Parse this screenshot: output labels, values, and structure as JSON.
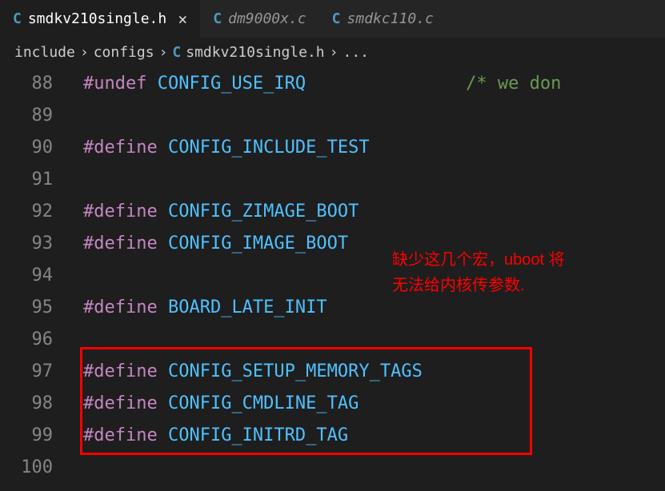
{
  "tabs": [
    {
      "icon": "C",
      "name": "smdkv210single.h",
      "active": true,
      "close": "×"
    },
    {
      "icon": "C",
      "name": "dm9000x.c",
      "active": false
    },
    {
      "icon": "C",
      "name": "smdkc110.c",
      "active": false
    }
  ],
  "breadcrumb": {
    "parts": [
      "include",
      "configs"
    ],
    "file_icon": "C",
    "file": "smdkv210single.h",
    "more": "..."
  },
  "lines": [
    {
      "num": "88",
      "prefix": "#undef ",
      "macro": "CONFIG_USE_IRQ",
      "suffix": "",
      "comment": "/* we don"
    },
    {
      "num": "89",
      "empty": true
    },
    {
      "num": "90",
      "prefix": "#define ",
      "macro": "CONFIG_INCLUDE_TEST"
    },
    {
      "num": "91",
      "empty": true
    },
    {
      "num": "92",
      "prefix": "#define ",
      "macro": "CONFIG_ZIMAGE_BOOT"
    },
    {
      "num": "93",
      "prefix": "#define ",
      "macro": "CONFIG_IMAGE_BOOT"
    },
    {
      "num": "94",
      "empty": true
    },
    {
      "num": "95",
      "prefix": "#define ",
      "macro": "BOARD_LATE_INIT"
    },
    {
      "num": "96",
      "empty": true
    },
    {
      "num": "97",
      "prefix": "#define ",
      "macro": "CONFIG_SETUP_MEMORY_TAGS"
    },
    {
      "num": "98",
      "prefix": "#define ",
      "macro": "CONFIG_CMDLINE_TAG"
    },
    {
      "num": "99",
      "prefix": "#define ",
      "macro": "CONFIG_INITRD_TAG"
    },
    {
      "num": "100",
      "empty": true
    }
  ],
  "annotation": {
    "line1": "缺少这几个宏，uboot 将",
    "line2": "无法给内核传参数."
  }
}
